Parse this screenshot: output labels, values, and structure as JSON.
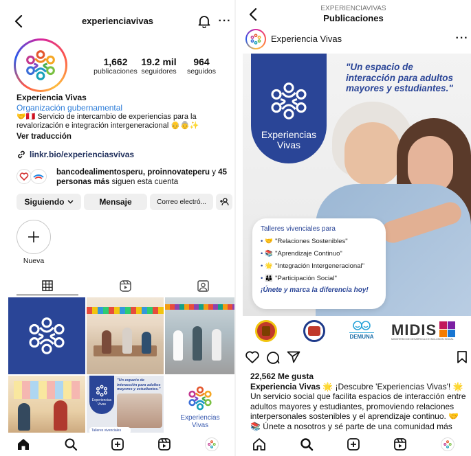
{
  "colors": {
    "brand_blue": "#2a4597",
    "link_blue": "#2a7bd8",
    "hashtag_blue": "#1d3b8b",
    "muted": "#737373"
  },
  "left": {
    "header": {
      "username": "experienciavivas"
    },
    "stats": [
      {
        "value": "1,662",
        "label": "publicaciones"
      },
      {
        "value": "19.2 mil",
        "label": "seguidores"
      },
      {
        "value": "964",
        "label": "seguidos"
      }
    ],
    "profile": {
      "name": "Experiencia Vivas",
      "category": "Organización gubernamental",
      "bio": "🤝🇵🇪 Servicio de intercambio de experiencias para la revalorización e integración intergeneracional 👴👵✨",
      "translate": "Ver traducción",
      "link": "linkr.bio/experienciasvivas",
      "followed_by_names": "bancodealimentosperu, proinnovateperu",
      "followed_by_suffix": " y",
      "followed_by_more": "45 personas más",
      "followed_by_tail": " siguen esta cuenta"
    },
    "buttons": {
      "following": "Siguiendo",
      "message": "Mensaje",
      "email": "Correo electró...",
      "add_person": "+👤"
    },
    "highlight": {
      "label": "Nueva"
    },
    "grid_tiles": [
      {
        "name": "logo-tile",
        "caption": ""
      },
      {
        "name": "workshop-tile",
        "caption": ""
      },
      {
        "name": "dance-tile",
        "caption": ""
      },
      {
        "name": "classroom-tile",
        "caption": ""
      },
      {
        "name": "poster-tile",
        "caption": "\"Un espacio de interacción para adultos mayores y estudiantes.\"",
        "label": "Experiencias Vivas",
        "footer": "Talleres vivenciales para"
      },
      {
        "name": "brand-tile",
        "caption": "",
        "label": "Experiencias Vivas"
      }
    ]
  },
  "right": {
    "header": {
      "account": "EXPERIENCIAVIVAS",
      "title": "Publicaciones"
    },
    "post": {
      "author": "Experiencia Vivas",
      "quote": "\"Un espacio de interacción para adultos mayores y estudiantes.\"",
      "banner_label": "Experiencias Vivas",
      "card_title": "Talleres vivenciales para",
      "card_items": [
        {
          "emoji": "🤝",
          "text": "\"Relaciones Sostenibles\""
        },
        {
          "emoji": "📚",
          "text": "\"Aprendizaje Continuo\""
        },
        {
          "emoji": "🌟",
          "text": "\"Integración Intergeneracional\""
        },
        {
          "emoji": "👪",
          "text": "\"Participación Social\""
        }
      ],
      "card_cta": "¡Únete y marca la diferencia hoy!",
      "partners": {
        "demuna": "DEMUNA",
        "midis": "MIDIS",
        "midis_sub": "MINISTERIO DE DESARROLLO E INCLUSIÓN SOCIAL"
      },
      "likes": "22,562 Me gusta",
      "caption_author": "Experiencia Vivas",
      "caption_text": " 🌟 ¡Descubre 'Experiencias Vivas'! 🌟 Un servicio social que facilita espacios de interacción entre adultos mayores y estudiantes, promoviendo relaciones interpersonales sostenibles y el aprendizaje continuo. 🤝📚 Únete a nosotros y sé parte de una comunidad más unida e inclusiva. ¡Transforma vidas hoy! #ExperienciasVivas"
    }
  }
}
